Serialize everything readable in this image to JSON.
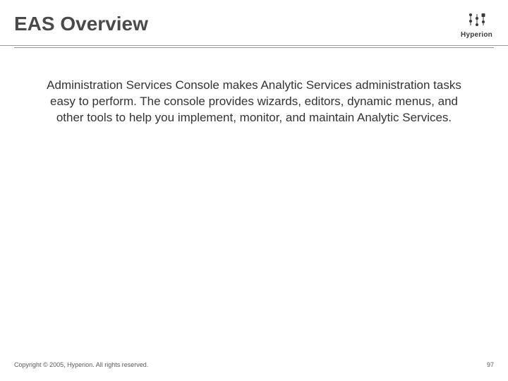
{
  "header": {
    "title": "EAS Overview",
    "logo_text": "Hyperion"
  },
  "body": {
    "paragraph": "Administration Services Console makes Analytic Services administration tasks easy to perform. The console provides wizards, editors, dynamic menus, and other tools to help you implement, monitor, and maintain Analytic Services."
  },
  "footer": {
    "copyright": "Copyright © 2005, Hyperion. All rights reserved.",
    "page_number": "97"
  }
}
